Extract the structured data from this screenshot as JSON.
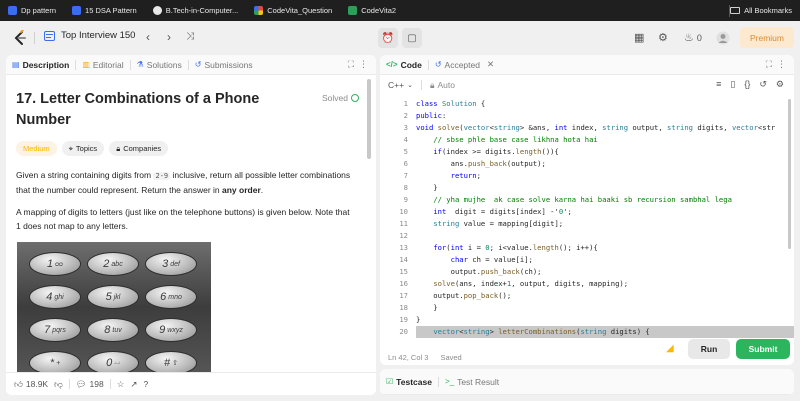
{
  "bookmarks": {
    "items": [
      {
        "label": "Dp pattern",
        "color": "#3a6df0"
      },
      {
        "label": "15 DSA Pattern",
        "color": "#3a6df0"
      },
      {
        "label": "B.Tech-in-Computer...",
        "color": "#e8e8e8"
      },
      {
        "label": "CodeVita_Question",
        "color": "#e84a3a"
      },
      {
        "label": "CodeVita2",
        "color": "#2aa05a"
      }
    ],
    "all_label": "All Bookmarks"
  },
  "nav": {
    "problem_list": "Top Interview 150",
    "premium": "Premium",
    "streak": "0"
  },
  "left_tabs": {
    "description": "Description",
    "editorial": "Editorial",
    "solutions": "Solutions",
    "submissions": "Submissions"
  },
  "problem": {
    "title": "17. Letter Combinations of a Phone Number",
    "status": "Solved",
    "difficulty": "Medium",
    "topics": "Topics",
    "companies": "Companies",
    "p1_a": "Given a string containing digits from ",
    "p1_code": "2-9",
    "p1_b": " inclusive, return all possible letter combinations that the number could represent. Return the answer in ",
    "p1_bold": "any order",
    "p1_c": ".",
    "p2": "A mapping of digits to letters (just like on the telephone buttons) is given below. Note that 1 does not map to any letters."
  },
  "keypad": {
    "keys": [
      {
        "num": "1",
        "letters": "ᴑᴑ"
      },
      {
        "num": "2",
        "letters": "abc"
      },
      {
        "num": "3",
        "letters": "def"
      },
      {
        "num": "4",
        "letters": "ghi"
      },
      {
        "num": "5",
        "letters": "jkl"
      },
      {
        "num": "6",
        "letters": "mno"
      },
      {
        "num": "7",
        "letters": "pqrs"
      },
      {
        "num": "8",
        "letters": "tuv"
      },
      {
        "num": "9",
        "letters": "wxyz"
      },
      {
        "num": "*",
        "letters": "+"
      },
      {
        "num": "0",
        "letters": "⌴"
      },
      {
        "num": "#",
        "letters": "⇧"
      }
    ]
  },
  "footer": {
    "likes": "18.9K",
    "comments": "198"
  },
  "code_tabs": {
    "code": "Code",
    "accepted": "Accepted"
  },
  "editor": {
    "language": "C++",
    "mode": "Auto",
    "status": "Ln 42, Col 3",
    "saved": "Saved",
    "run": "Run",
    "submit": "Submit"
  },
  "bottom_tabs": {
    "testcase": "Testcase",
    "test_result": "Test Result"
  },
  "code_lines": [
    "class Solution {",
    "public:",
    "void solve(vector<string> &ans, int index, string output, string digits, vector<str",
    "    // sbse phle base case likhna hota hai",
    "    if(index >= digits.length()){",
    "        ans.push_back(output);",
    "        return;",
    "    }",
    "    // yha mujhe  ak case solve karna hai baaki sb recursion sambhal lega",
    "    int  digit = digits[index] -'0';",
    "    string value = mapping[digit];",
    "",
    "    for(int i = 0; i<value.length(); i++){",
    "        char ch = value[i];",
    "        output.push_back(ch);",
    "    solve(ans, index+1, output, digits, mapping);",
    "    output.pop_back();",
    "    }",
    "}",
    "    vector<string> letterCombinations(string digits) {"
  ]
}
